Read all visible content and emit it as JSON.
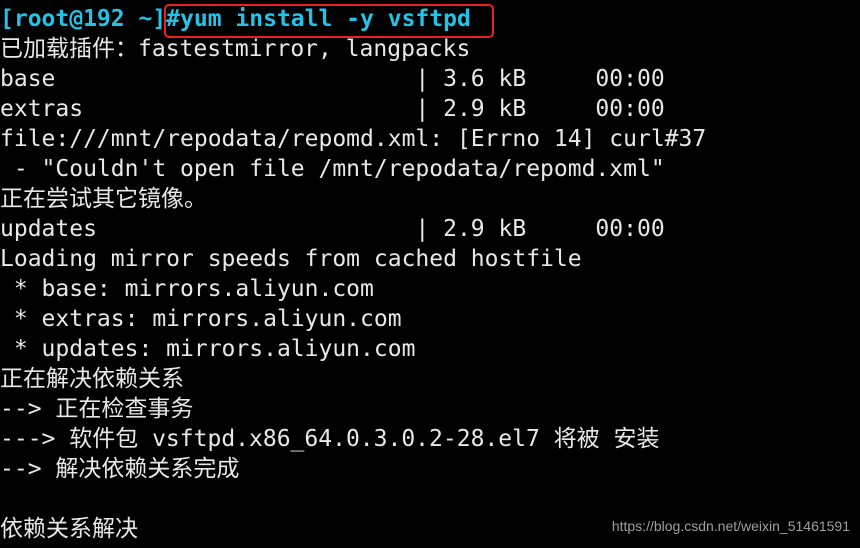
{
  "terminal": {
    "prompt": "[root@192 ~]",
    "command": "#yum install -y vsftpd",
    "lines": [
      "已加载插件：fastestmirror, langpacks",
      "base                          | 3.6 kB     00:00",
      "extras                        | 2.9 kB     00:00",
      "file:///mnt/repodata/repomd.xml: [Errno 14] curl#37",
      " - \"Couldn't open file /mnt/repodata/repomd.xml\"",
      "正在尝试其它镜像。",
      "updates                       | 2.9 kB     00:00",
      "Loading mirror speeds from cached hostfile",
      " * base: mirrors.aliyun.com",
      " * extras: mirrors.aliyun.com",
      " * updates: mirrors.aliyun.com",
      "正在解决依赖关系",
      "--> 正在检查事务",
      "---> 软件包 vsftpd.x86_64.0.3.0.2-28.el7 将被 安装",
      "--> 解决依赖关系完成",
      "",
      "依赖关系解决"
    ]
  },
  "watermark": "https://blog.csdn.net/weixin_51461591",
  "colors": {
    "prompt": "#22c3e6",
    "highlight_box": "#e8231f",
    "text": "#e8e8e8",
    "background": "#000000"
  }
}
